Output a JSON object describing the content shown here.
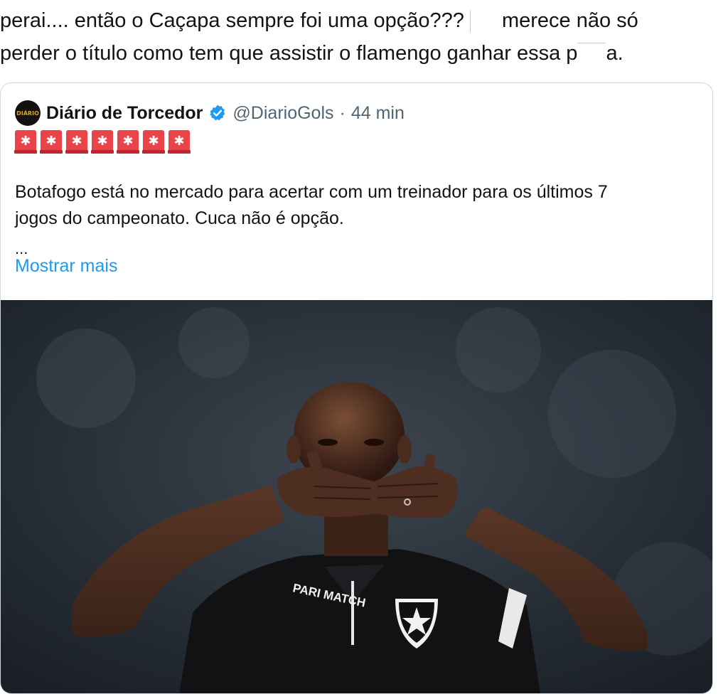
{
  "tweet": {
    "line1_before": "perai.... então o Caçapa sempre foi uma opção???",
    "line1_after": "merece não só",
    "line2_before": "perder o título como tem que assistir o flamengo ganhar essa p",
    "line2_after": "a."
  },
  "quote": {
    "avatar_text": "DIÁRIO",
    "display_name": "Diário de Torcedor",
    "handle": "@DiarioGols",
    "separator": "·",
    "time": "44 min",
    "alert_icon_count": 7,
    "body_line1": "Botafogo está no mercado para acertar com um treinador para os últimos 7",
    "body_line2": "jogos do campeonato. Cuca não é opção.",
    "ellipsis": "...",
    "show_more": "Mostrar mais"
  },
  "photo": {
    "jersey_sponsor": "PARI MATCH",
    "icon": "botafogo-crest-star"
  },
  "colors": {
    "link": "#1d9bf0",
    "secondary_text": "#536471",
    "verified": "#1d9bf0",
    "alert": "#e8444a"
  }
}
